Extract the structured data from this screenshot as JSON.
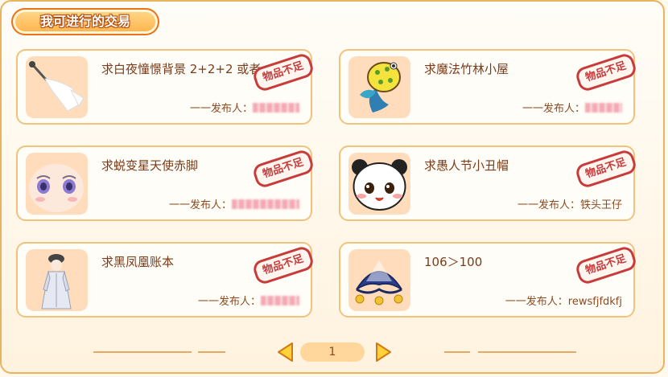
{
  "header": {
    "title": "我可进行的交易"
  },
  "trades": [
    {
      "item": "求白夜憧憬背景 2+2+2 或者",
      "poster_prefix": "一一发布人：",
      "poster": "",
      "status": "物品不足"
    },
    {
      "item": "求魔法竹林小屋",
      "poster_prefix": "一一发布人：",
      "poster": "",
      "status": "物品不足"
    },
    {
      "item": "求蜕变星天使赤脚",
      "poster_prefix": "一一发布人：",
      "poster": "",
      "status": "物品不足"
    },
    {
      "item": "求愚人节小丑帽",
      "poster_prefix": "一一发布人：",
      "poster": "铁头王仔",
      "status": "物品不足"
    },
    {
      "item": "求黑凤凰账本",
      "poster_prefix": "一一发布人：",
      "poster": "",
      "status": "物品不足"
    },
    {
      "item": "106＞100",
      "poster_prefix": "一一发布人：",
      "poster": "rewsfjfdkfj",
      "status": "物品不足"
    }
  ],
  "pager": {
    "current": "1"
  },
  "colors": {
    "accent": "#ffb24a",
    "stamp": "#c83b3b",
    "card_border": "#f2c27b"
  }
}
